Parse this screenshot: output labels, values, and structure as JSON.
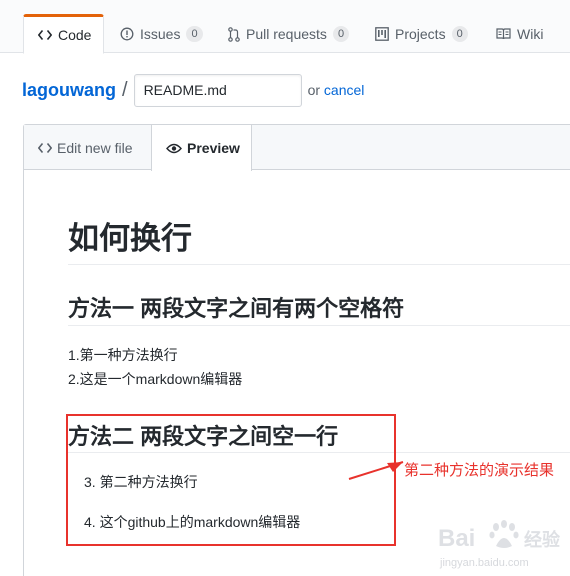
{
  "repo_nav": {
    "tabs": [
      {
        "label": "Code",
        "icon": "code-icon"
      },
      {
        "label": "Issues",
        "count": "0",
        "icon": "issue-opened-icon"
      },
      {
        "label": "Pull requests",
        "count": "0",
        "icon": "git-pull-request-icon"
      },
      {
        "label": "Projects",
        "count": "0",
        "icon": "project-icon"
      },
      {
        "label": "Wiki",
        "icon": "book-icon"
      }
    ]
  },
  "breadcrumb": {
    "repo": "lagouwang",
    "separator": "/",
    "filename": "README.md",
    "or_text": "or",
    "cancel": "cancel"
  },
  "editor": {
    "tabs": [
      {
        "label": "Edit new file",
        "icon": "code-icon"
      },
      {
        "label": "Preview",
        "icon": "eye-icon"
      }
    ]
  },
  "preview": {
    "h1": "如何换行",
    "h2_method1": "方法一 两段文字之间有两个空格符",
    "line1": "1.第一种方法换行",
    "line2": "2.这是一个markdown编辑器",
    "h2_method2": "方法二 两段文字之间空一行",
    "item3": "3. 第二种方法换行",
    "item4": "4. 这个github上的markdown编辑器"
  },
  "annotation": {
    "note": "第二种方法的演示结果",
    "color": "#e8322c"
  },
  "watermark": {
    "brand": "Bai",
    "cn": "经验",
    "url": "jingyan.baidu.com"
  },
  "colors": {
    "accent_orange": "#e36209",
    "link_blue": "#0366d6"
  }
}
